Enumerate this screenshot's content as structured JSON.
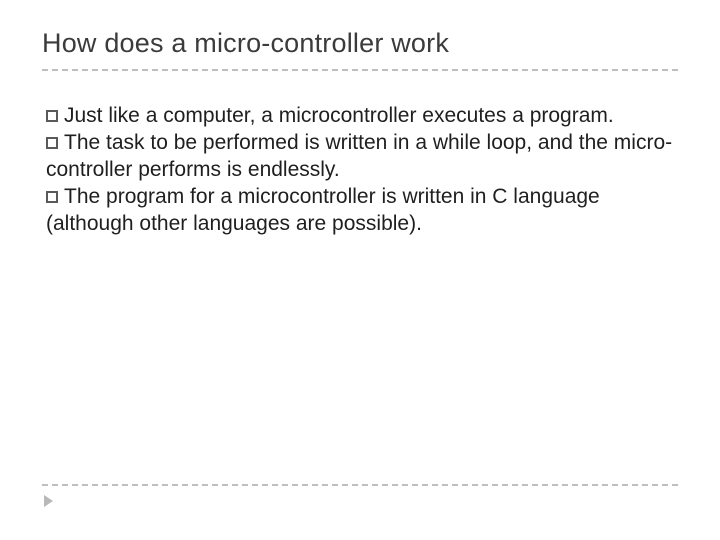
{
  "title": "How does a micro-controller work",
  "bullets": [
    "Just like a computer, a microcontroller executes a program.",
    "The task to be performed is written in a while loop, and the micro-controller performs is endlessly.",
    "The program for a microcontroller is written in C language (although other languages are possible)."
  ]
}
